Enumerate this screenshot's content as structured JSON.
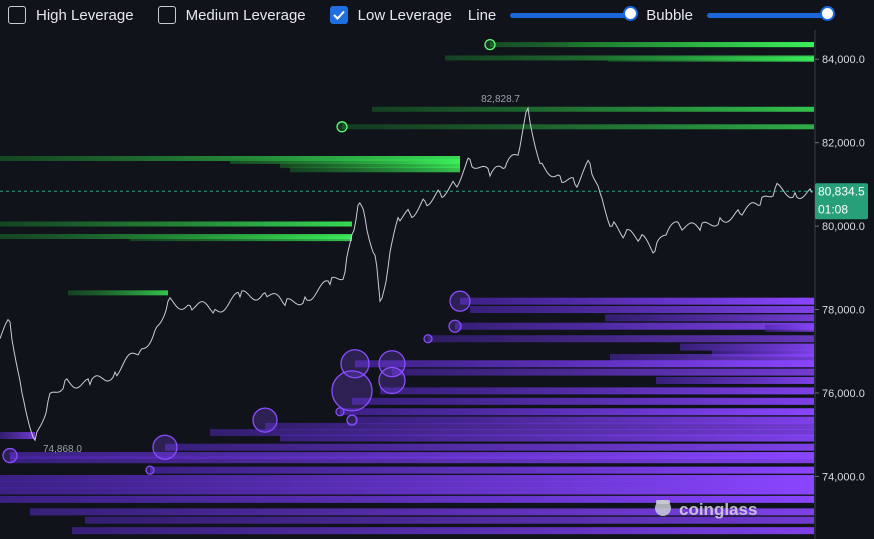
{
  "toolbar": {
    "high_leverage": {
      "label": "High Leverage",
      "checked": false
    },
    "medium_leverage": {
      "label": "Medium Leverage",
      "checked": false
    },
    "low_leverage": {
      "label": "Low Leverage",
      "checked": true
    },
    "line_label": "Line",
    "line_value": 1.0,
    "bubble_label": "Bubble",
    "bubble_value": 1.0
  },
  "watermark": "coinglass",
  "colors": {
    "background": "#10131a",
    "short_liq": "#33e24f",
    "long_liq": "#7b3cf0",
    "price_line": "#c8ccd2",
    "current_badge": "#27a07a",
    "accent": "#1b66d8"
  },
  "chart_data": {
    "type": "line",
    "ylim": [
      72500,
      84700
    ],
    "yticks": [
      74000,
      76000,
      78000,
      80000,
      82000,
      84000
    ],
    "ytick_labels": [
      "74,000.0",
      "76,000.0",
      "78,000.0",
      "80,000.0",
      "82,000.0",
      "84,000.0"
    ],
    "current_price": {
      "value": 80834.5,
      "label": "80,834.5",
      "timer": "01:08"
    },
    "high_label": {
      "value": 82828.7,
      "label": "82,828.7"
    },
    "low_label": {
      "value": 74868.0,
      "label": "74,868.0"
    },
    "price_path": [
      [
        0,
        77300
      ],
      [
        10,
        77700
      ],
      [
        22,
        76000
      ],
      [
        35,
        74868
      ],
      [
        48,
        75800
      ],
      [
        65,
        76300
      ],
      [
        90,
        76200
      ],
      [
        115,
        76500
      ],
      [
        140,
        77000
      ],
      [
        155,
        77500
      ],
      [
        168,
        78200
      ],
      [
        190,
        78100
      ],
      [
        215,
        78000
      ],
      [
        240,
        78300
      ],
      [
        265,
        78400
      ],
      [
        285,
        78100
      ],
      [
        305,
        78300
      ],
      [
        330,
        78600
      ],
      [
        345,
        78900
      ],
      [
        352,
        79800
      ],
      [
        358,
        80500
      ],
      [
        365,
        80200
      ],
      [
        375,
        79300
      ],
      [
        380,
        78200
      ],
      [
        388,
        79000
      ],
      [
        398,
        80200
      ],
      [
        410,
        80300
      ],
      [
        425,
        80600
      ],
      [
        440,
        80800
      ],
      [
        455,
        81000
      ],
      [
        470,
        81600
      ],
      [
        490,
        81200
      ],
      [
        505,
        81400
      ],
      [
        518,
        81700
      ],
      [
        528,
        82828
      ],
      [
        540,
        81500
      ],
      [
        560,
        81200
      ],
      [
        575,
        81000
      ],
      [
        590,
        81500
      ],
      [
        600,
        80800
      ],
      [
        612,
        80000
      ],
      [
        625,
        79800
      ],
      [
        640,
        79700
      ],
      [
        655,
        79400
      ],
      [
        668,
        79900
      ],
      [
        680,
        80000
      ],
      [
        700,
        79900
      ],
      [
        720,
        80200
      ],
      [
        740,
        80300
      ],
      [
        760,
        80500
      ],
      [
        775,
        80900
      ],
      [
        795,
        80800
      ],
      [
        812,
        80800
      ]
    ],
    "short_liquidation_lines": [
      {
        "price": 84350,
        "start": 490,
        "strength": 1.0
      },
      {
        "price": 84350,
        "start": 568,
        "strength": 0.9
      },
      {
        "price": 84030,
        "start": 445,
        "strength": 0.8
      },
      {
        "price": 84000,
        "start": 608,
        "strength": 0.9
      },
      {
        "price": 82800,
        "start": 372,
        "strength": 0.8
      },
      {
        "price": 82380,
        "start": 342,
        "strength": 0.7
      },
      {
        "price": 81620,
        "start": 0,
        "end": 460,
        "strength": 0.9
      },
      {
        "price": 81550,
        "start": 230,
        "end": 460,
        "strength": 1.0
      },
      {
        "price": 81450,
        "start": 280,
        "end": 460,
        "strength": 0.9
      },
      {
        "price": 81350,
        "start": 290,
        "end": 460,
        "strength": 0.8
      },
      {
        "price": 80050,
        "start": 0,
        "end": 352,
        "strength": 0.9
      },
      {
        "price": 79750,
        "start": 0,
        "end": 352,
        "strength": 0.9
      },
      {
        "price": 79700,
        "start": 130,
        "end": 352,
        "strength": 0.8
      },
      {
        "price": 78400,
        "start": 68,
        "end": 168,
        "strength": 0.8
      }
    ],
    "long_liquidation_lines": [
      {
        "price": 78200,
        "start": 460,
        "strength": 1.0
      },
      {
        "price": 78000,
        "start": 470,
        "strength": 0.9
      },
      {
        "price": 77800,
        "start": 605,
        "strength": 0.8
      },
      {
        "price": 77600,
        "start": 455,
        "strength": 0.9
      },
      {
        "price": 77550,
        "start": 765,
        "strength": 0.8
      },
      {
        "price": 77300,
        "start": 428,
        "strength": 0.7
      },
      {
        "price": 77100,
        "start": 680,
        "strength": 0.9
      },
      {
        "price": 76950,
        "start": 712,
        "strength": 0.9
      },
      {
        "price": 76850,
        "start": 610,
        "strength": 0.8
      },
      {
        "price": 76700,
        "start": 355,
        "strength": 1.0
      },
      {
        "price": 76500,
        "start": 392,
        "strength": 0.8
      },
      {
        "price": 76300,
        "start": 656,
        "strength": 0.9
      },
      {
        "price": 76050,
        "start": 380,
        "strength": 0.9
      },
      {
        "price": 75800,
        "start": 352,
        "strength": 0.9
      },
      {
        "price": 75550,
        "start": 340,
        "strength": 1.0
      },
      {
        "price": 75350,
        "start": 355,
        "strength": 0.9
      },
      {
        "price": 75200,
        "start": 265,
        "strength": 0.8
      },
      {
        "price": 75050,
        "start": 210,
        "strength": 0.8
      },
      {
        "price": 74920,
        "start": 280,
        "strength": 0.9
      },
      {
        "price": 74980,
        "start": 0,
        "end": 35,
        "strength": 0.8
      },
      {
        "price": 74700,
        "start": 165,
        "strength": 0.9
      },
      {
        "price": 74500,
        "start": 10,
        "strength": 1.0
      },
      {
        "price": 74400,
        "start": 10,
        "strength": 0.9
      },
      {
        "price": 74150,
        "start": 150,
        "strength": 1.0
      },
      {
        "price": 73950,
        "start": 0,
        "strength": 1.0
      },
      {
        "price": 73800,
        "start": 0,
        "strength": 1.0
      },
      {
        "price": 73650,
        "start": 0,
        "strength": 1.0
      },
      {
        "price": 73450,
        "start": 0,
        "strength": 1.0
      },
      {
        "price": 73150,
        "start": 30,
        "strength": 0.9
      },
      {
        "price": 72950,
        "start": 85,
        "strength": 0.8
      },
      {
        "price": 72700,
        "start": 72,
        "strength": 0.9
      }
    ],
    "bubbles": [
      {
        "price": 84350,
        "start": 490,
        "size": 5,
        "color": "green"
      },
      {
        "price": 82380,
        "start": 342,
        "size": 5,
        "color": "green"
      },
      {
        "price": 78200,
        "start": 460,
        "size": 10,
        "color": "purple"
      },
      {
        "price": 76700,
        "start": 355,
        "size": 14,
        "color": "purple"
      },
      {
        "price": 76700,
        "start": 392,
        "size": 13,
        "color": "purple"
      },
      {
        "price": 76300,
        "start": 392,
        "size": 13,
        "color": "purple"
      },
      {
        "price": 76050,
        "start": 352,
        "size": 20,
        "color": "purple"
      },
      {
        "price": 75350,
        "start": 265,
        "size": 12,
        "color": "purple"
      },
      {
        "price": 74700,
        "start": 165,
        "size": 12,
        "color": "purple"
      },
      {
        "price": 74500,
        "start": 10,
        "size": 7,
        "color": "purple"
      },
      {
        "price": 77600,
        "start": 455,
        "size": 6,
        "color": "purple"
      },
      {
        "price": 77300,
        "start": 428,
        "size": 4,
        "color": "purple"
      },
      {
        "price": 75550,
        "start": 340,
        "size": 4,
        "color": "purple"
      },
      {
        "price": 75350,
        "start": 352,
        "size": 5,
        "color": "purple"
      },
      {
        "price": 74150,
        "start": 150,
        "size": 4,
        "color": "purple"
      }
    ]
  }
}
